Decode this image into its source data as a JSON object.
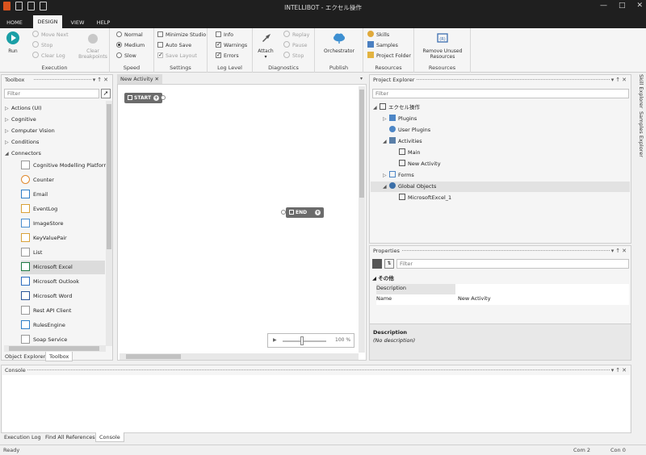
{
  "window": {
    "title": "INTELLIBOT - エクセル操作"
  },
  "menu": {
    "tabs": [
      "HOME",
      "DESIGN",
      "VIEW",
      "HELP"
    ],
    "active": "DESIGN"
  },
  "ribbon": {
    "execution": {
      "label": "Execution",
      "run": "Run",
      "move_next": "Move Next",
      "stop": "Stop",
      "clear_log": "Clear Log",
      "clear_breakpoints": "Clear Breakpoints"
    },
    "speed": {
      "label": "Speed",
      "options": [
        "Normal",
        "Medium",
        "Slow"
      ],
      "selected": "Medium"
    },
    "settings": {
      "label": "Settings",
      "minimize_studio": "Minimize Studio",
      "auto_save": "Auto Save",
      "save_layout": "Save Layout"
    },
    "log_level": {
      "label": "Log Level",
      "info": "Info",
      "warnings": "Warnings",
      "errors": "Errors"
    },
    "diagnostics": {
      "label": "Diagnostics",
      "attach": "Attach",
      "replay": "Replay",
      "pause": "Pause",
      "stop": "Stop"
    },
    "publish": {
      "label": "Publish",
      "orchestrator": "Orchestrator"
    },
    "resources": {
      "label": "Resources",
      "skills": "Skills",
      "samples": "Samples",
      "project_folder": "Project Folder"
    },
    "resources2": {
      "label": "Resources",
      "remove_unused": "Remove Unused Resources"
    }
  },
  "toolbox": {
    "title": "Toolbox",
    "filter_placeholder": "Filter",
    "categories": [
      "Actions (UI)",
      "Cognitive",
      "Computer Vision",
      "Conditions",
      "Connectors"
    ],
    "connectors": [
      "Cognitive Modelling Platform",
      "Counter",
      "Email",
      "EventLog",
      "ImageStore",
      "KeyValuePair",
      "List",
      "Microsoft Excel",
      "Microsoft Outlook",
      "Microsoft Word",
      "Rest API Client",
      "RulesEngine",
      "Soap Service"
    ],
    "selected": "Microsoft Excel",
    "bottom_tabs": [
      "Object Explorer",
      "Toolbox"
    ],
    "active_bottom_tab": "Toolbox"
  },
  "editor": {
    "tab": "New Activity",
    "start_node": "START",
    "end_node": "END",
    "zoom": "100 %"
  },
  "project_explorer": {
    "title": "Project Explorer",
    "filter_placeholder": "Filter",
    "root": "エクセル操作",
    "plugins": "Plugins",
    "user_plugins": "User Plugins",
    "activities": "Activities",
    "main": "Main",
    "new_activity": "New Activity",
    "forms": "Forms",
    "global_objects": "Global Objects",
    "excel_object": "MicrosoftExcel_1"
  },
  "properties": {
    "title": "Properties",
    "filter_placeholder": "Filter",
    "group": "その他",
    "rows": [
      {
        "key": "Description",
        "value": ""
      },
      {
        "key": "Name",
        "value": "New Activity"
      }
    ],
    "desc_title": "Description",
    "desc_text": "(No description)"
  },
  "side_tabs": [
    "Skill Explorer",
    "Samples Explorer"
  ],
  "console": {
    "title": "Console",
    "tabs": [
      "Execution Log",
      "Find All References",
      "Console"
    ],
    "active": "Console"
  },
  "status": {
    "left": "Ready",
    "com2": "Com 2",
    "coln": "Con 0"
  }
}
